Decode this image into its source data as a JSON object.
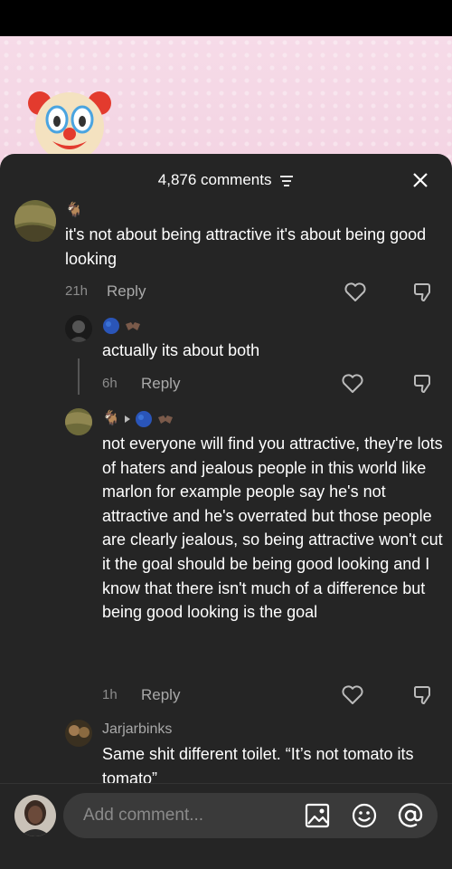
{
  "header": {
    "comment_count": "4,876 comments"
  },
  "comments": [
    {
      "username_emoji": "🐐",
      "text": "it's not about being attractive it's about being good looking",
      "time": "21h",
      "reply_label": "Reply"
    },
    {
      "text": "actually its about both",
      "time": "6h",
      "reply_label": "Reply"
    },
    {
      "username_emoji": "🐐",
      "text": "not everyone will find you attractive, they're lots of haters and jealous people in this world like marlon for example people say he's not attractive and he's overrated but those people are clearly jealous, so being attractive won't cut it the goal should be being good looking and I know that there isn't much of a difference but being good looking is the goal",
      "time": "1h",
      "reply_label": "Reply"
    },
    {
      "username": "Jarjarbinks",
      "text": "Same shit different toilet. “It’s not tomato its tomato”"
    }
  ],
  "composer": {
    "placeholder": "Add comment..."
  },
  "colors": {
    "sheet_bg": "#252525",
    "input_bg": "#3a3a3a",
    "page_bg": "#f3d3e2"
  }
}
